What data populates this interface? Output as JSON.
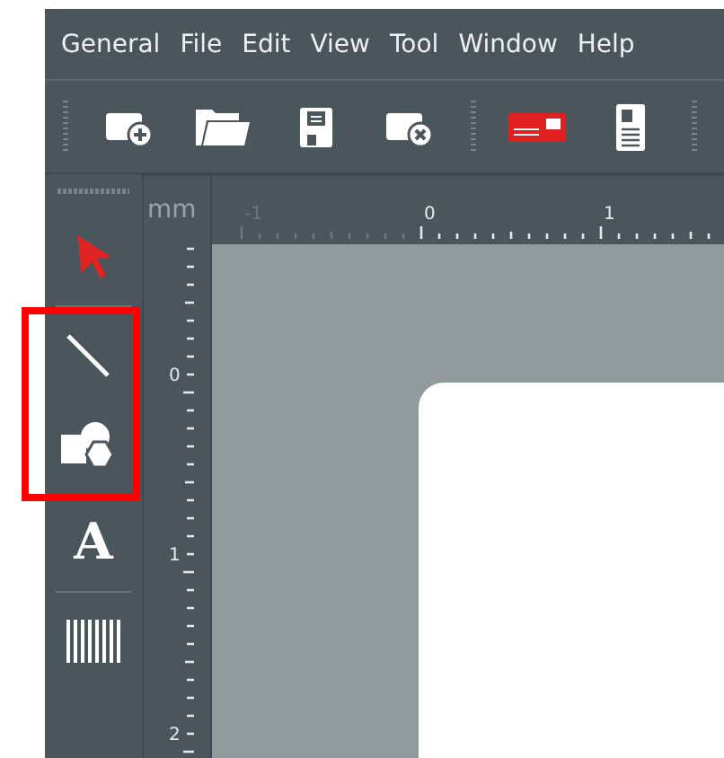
{
  "menu_bar": {
    "items": [
      "General",
      "File",
      "Edit",
      "View",
      "Tool",
      "Window",
      "Help"
    ]
  },
  "toolbar": {
    "groups": [
      [
        {
          "kind": "new"
        },
        {
          "kind": "open"
        },
        {
          "kind": "save"
        },
        {
          "kind": "close"
        }
      ],
      [
        {
          "kind": "label"
        },
        {
          "kind": "document"
        }
      ]
    ]
  },
  "tool_panel": {
    "tools": [
      {
        "kind": "pointer",
        "selected": true,
        "highlighted": false
      },
      {
        "kind": "line",
        "selected": false,
        "highlighted": true
      },
      {
        "kind": "shapes",
        "selected": false,
        "highlighted": true
      },
      {
        "kind": "text",
        "glyph": "A",
        "selected": false,
        "highlighted": false
      },
      {
        "kind": "barcode",
        "selected": false,
        "highlighted": false
      }
    ]
  },
  "rulers": {
    "unit": "mm",
    "top_labels": [
      "-1",
      "0",
      "1"
    ],
    "left_labels": [
      "0",
      "1",
      "2"
    ]
  }
}
